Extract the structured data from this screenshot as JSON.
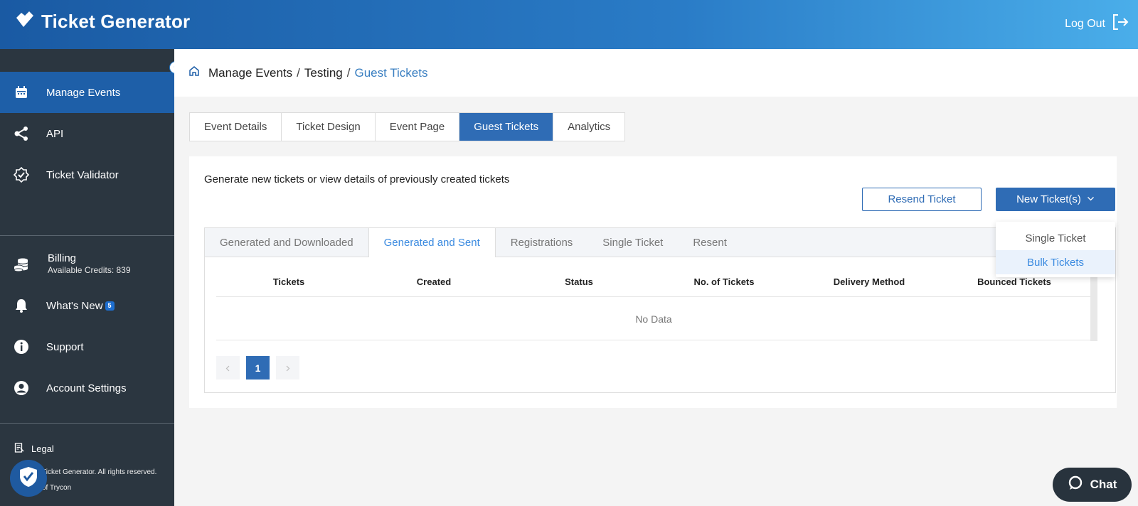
{
  "header": {
    "app_title": "Ticket Generator",
    "logout_label": "Log Out"
  },
  "sidebar": {
    "items": [
      {
        "label": "Manage Events",
        "icon": "calendar-icon",
        "active": true
      },
      {
        "label": "API",
        "icon": "share-icon"
      },
      {
        "label": "Ticket Validator",
        "icon": "badge-check-icon"
      }
    ],
    "billing": {
      "label": "Billing",
      "credits": "Available Credits: 839"
    },
    "whats_new": {
      "label": "What's New",
      "badge": "5"
    },
    "support_label": "Support",
    "account_label": "Account Settings",
    "legal_label": "Legal",
    "copyright_line1": "Ticket Generator. All rights reserved.",
    "copyright_line2": "of Trycon"
  },
  "breadcrumb": {
    "items": [
      "Manage Events",
      "Testing"
    ],
    "current": "Guest Tickets",
    "separator": "/"
  },
  "tabs": [
    "Event Details",
    "Ticket Design",
    "Event Page",
    "Guest Tickets",
    "Analytics"
  ],
  "active_tab": "Guest Tickets",
  "card": {
    "description": "Generate new tickets or view details of previously created tickets",
    "resend_label": "Resend Ticket",
    "new_label": "New Ticket(s)"
  },
  "subtabs": [
    "Generated and Downloaded",
    "Generated and Sent",
    "Registrations",
    "Single Ticket",
    "Resent"
  ],
  "active_subtab": "Generated and Sent",
  "table": {
    "columns": [
      "Tickets",
      "Created",
      "Status",
      "No. of Tickets",
      "Delivery Method",
      "Bounced Tickets"
    ],
    "empty_text": "No Data"
  },
  "pagination": {
    "current_page": "1"
  },
  "dropdown": {
    "items": [
      "Single Ticket",
      "Bulk Tickets"
    ],
    "hovered": "Bulk Tickets"
  },
  "chat_label": "Chat",
  "colors": {
    "primary": "#2f6cb5",
    "sidebar": "#2b3640",
    "active_nav": "#1e5fa8",
    "link": "#3a7fc1"
  }
}
